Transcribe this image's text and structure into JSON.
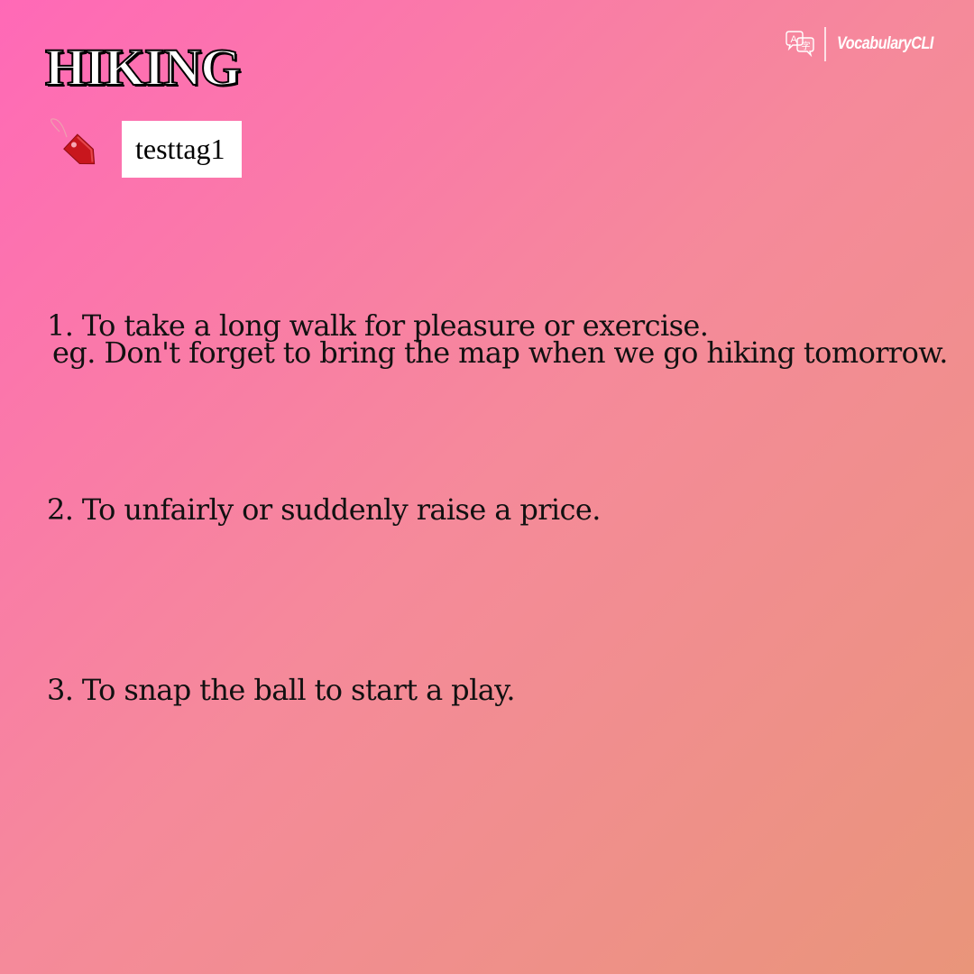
{
  "word": "HIKING",
  "tag": {
    "label": "testtag1",
    "icon": "price-tag-icon"
  },
  "brand": {
    "name": "VocabularyCLI",
    "icon": "translate-icon"
  },
  "definitions": [
    {
      "text": "1. To take a long walk for pleasure or exercise.",
      "example": "eg. Don't forget to bring the map when we go hiking tomorrow."
    },
    {
      "text": "2. To unfairly or suddenly raise a price."
    },
    {
      "text": "3. To snap the ball to start a play."
    }
  ],
  "colors": {
    "gradient_start": "#ff69b7",
    "gradient_end": "#e9957a",
    "text": "#111111",
    "tag_red": "#c8161d"
  }
}
